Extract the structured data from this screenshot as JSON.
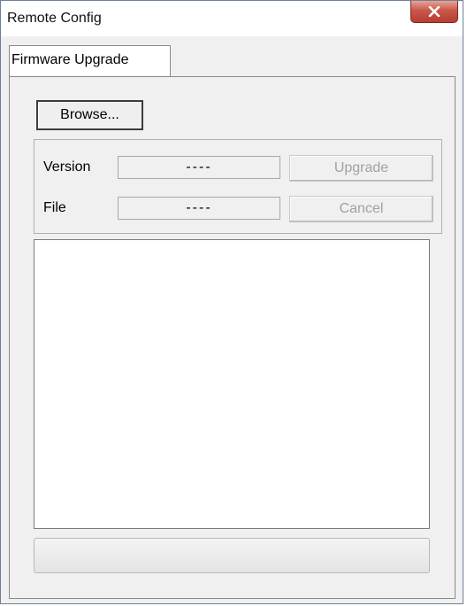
{
  "window": {
    "title": "Remote Config",
    "close_icon": "close-icon"
  },
  "tabs": [
    {
      "label": "Firmware Upgrade",
      "active": true
    }
  ],
  "main": {
    "browse_label": "Browse...",
    "version_label": "Version",
    "version_value": "----",
    "file_label": "File",
    "file_value": "----",
    "upgrade_label": "Upgrade",
    "cancel_label": "Cancel",
    "progress_fraction": 0
  }
}
